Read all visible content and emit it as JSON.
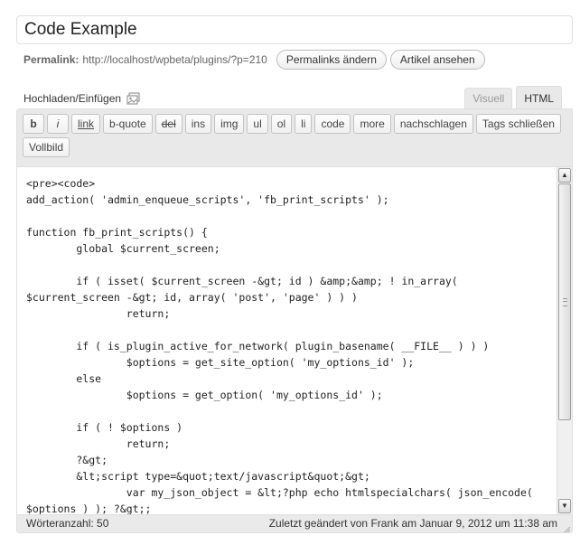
{
  "post": {
    "title": "Code Example"
  },
  "permalink": {
    "label": "Permalink:",
    "url": "http://localhost/wpbeta/plugins/?p=210",
    "change_button": "Permalinks ändern",
    "view_button": "Artikel ansehen"
  },
  "media": {
    "upload_label": "Hochladen/Einfügen",
    "icon": "media-icon"
  },
  "editor_tabs": {
    "visual": "Visuell",
    "html": "HTML",
    "active": "HTML"
  },
  "quicktags": [
    {
      "key": "b",
      "label": "b"
    },
    {
      "key": "i",
      "label": "i"
    },
    {
      "key": "link",
      "label": "link"
    },
    {
      "key": "b-quote",
      "label": "b-quote"
    },
    {
      "key": "del",
      "label": "del"
    },
    {
      "key": "ins",
      "label": "ins"
    },
    {
      "key": "img",
      "label": "img"
    },
    {
      "key": "ul",
      "label": "ul"
    },
    {
      "key": "ol",
      "label": "ol"
    },
    {
      "key": "li",
      "label": "li"
    },
    {
      "key": "code",
      "label": "code"
    },
    {
      "key": "more",
      "label": "more"
    },
    {
      "key": "lookup",
      "label": "nachschlagen"
    },
    {
      "key": "close-tags",
      "label": "Tags schließen"
    },
    {
      "key": "fullscreen",
      "label": "Vollbild"
    }
  ],
  "code_lines": [
    "<pre><code>",
    "add_action( 'admin_enqueue_scripts', 'fb_print_scripts' );",
    "",
    "function fb_print_scripts() {",
    "        global $current_screen;",
    "",
    "        if ( isset( $current_screen -&gt; id ) &amp;&amp; ! in_array(",
    "$current_screen -&gt; id, array( 'post', 'page' ) ) )",
    "                return;",
    "",
    "        if ( is_plugin_active_for_network( plugin_basename( __FILE__ ) ) )",
    "                $options = get_site_option( 'my_options_id' );",
    "        else",
    "                $options = get_option( 'my_options_id' );",
    "",
    "        if ( ! $options )",
    "                return;",
    "        ?&gt;",
    "        &lt;script type=&quot;text/javascript&quot;&gt;",
    "                var my_json_object = &lt;?php echo htmlspecialchars( json_encode(",
    "$options ) ); ?&gt;;"
  ],
  "status": {
    "word_count": "Wörteranzahl: 50",
    "last_edited": "Zuletzt geändert von Frank am Januar 9, 2012 um 11:38 am"
  }
}
